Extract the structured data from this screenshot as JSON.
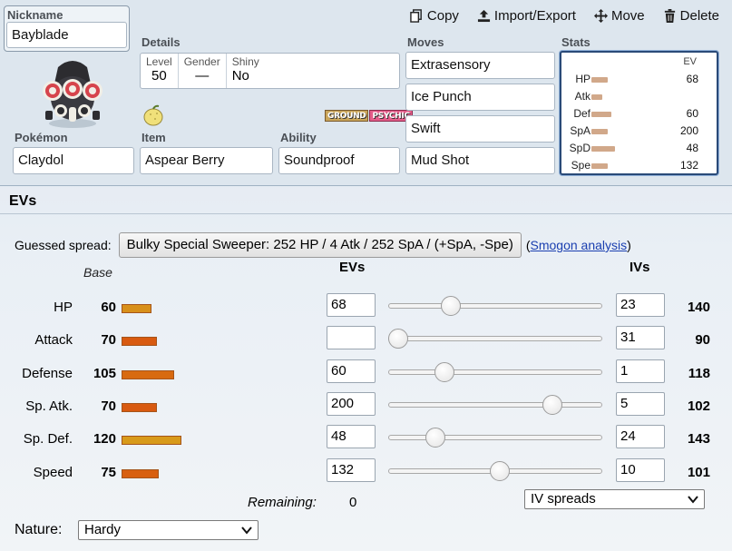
{
  "toolbar": {
    "copy": "Copy",
    "import_export": "Import/Export",
    "move": "Move",
    "delete": "Delete"
  },
  "nickname": {
    "label": "Nickname",
    "value": "Bayblade"
  },
  "details": {
    "label": "Details",
    "level_label": "Level",
    "level": "50",
    "gender_label": "Gender",
    "gender": "—",
    "shiny_label": "Shiny",
    "shiny": "No"
  },
  "types": [
    "GROUND",
    "PSYCHIC"
  ],
  "pokemon": {
    "label": "Pokémon",
    "value": "Claydol"
  },
  "item": {
    "label": "Item",
    "value": "Aspear Berry"
  },
  "ability": {
    "label": "Ability",
    "value": "Soundproof"
  },
  "moves": {
    "label": "Moves",
    "list": [
      "Extrasensory",
      "Ice Punch",
      "Swift",
      "Mud Shot"
    ]
  },
  "stats_panel": {
    "label": "Stats",
    "ev_header": "EV",
    "rows": [
      {
        "name": "HP",
        "ev": "68",
        "bar": 0.45
      },
      {
        "name": "Atk",
        "ev": "",
        "bar": 0.3
      },
      {
        "name": "Def",
        "ev": "60",
        "bar": 0.55
      },
      {
        "name": "SpA",
        "ev": "200",
        "bar": 0.45
      },
      {
        "name": "SpD",
        "ev": "48",
        "bar": 0.65
      },
      {
        "name": "Spe",
        "ev": "132",
        "bar": 0.45
      }
    ]
  },
  "evs": {
    "title": "EVs",
    "guessed_label": "Guessed spread:",
    "guessed_value": "Bulky Special Sweeper: 252 HP / 4 Atk / 252 SpA / (+SpA, -Spe)",
    "smogon_open": "(",
    "smogon_link": "Smogon analysis",
    "smogon_close": ")",
    "base_header": "Base",
    "evs_header": "EVs",
    "ivs_header": "IVs",
    "rows": [
      {
        "name": "HP",
        "base": "60",
        "ev": "68",
        "iv": "23",
        "total": "140",
        "slider": 68,
        "color": "#d8901a"
      },
      {
        "name": "Attack",
        "base": "70",
        "ev": "",
        "iv": "31",
        "total": "90",
        "slider": 0,
        "color": "#d85a10"
      },
      {
        "name": "Defense",
        "base": "105",
        "ev": "60",
        "iv": "1",
        "total": "118",
        "slider": 60,
        "color": "#d86a10"
      },
      {
        "name": "Sp. Atk.",
        "base": "70",
        "ev": "200",
        "iv": "5",
        "total": "102",
        "slider": 200,
        "color": "#d85a10"
      },
      {
        "name": "Sp. Def.",
        "base": "120",
        "ev": "48",
        "iv": "24",
        "total": "143",
        "slider": 48,
        "color": "#d89a1a"
      },
      {
        "name": "Speed",
        "base": "75",
        "ev": "132",
        "iv": "10",
        "total": "101",
        "slider": 132,
        "color": "#d86010"
      }
    ],
    "remaining_label": "Remaining:",
    "remaining_value": "0",
    "iv_spreads": "IV spreads",
    "nature_label": "Nature:",
    "nature_value": "Hardy"
  }
}
